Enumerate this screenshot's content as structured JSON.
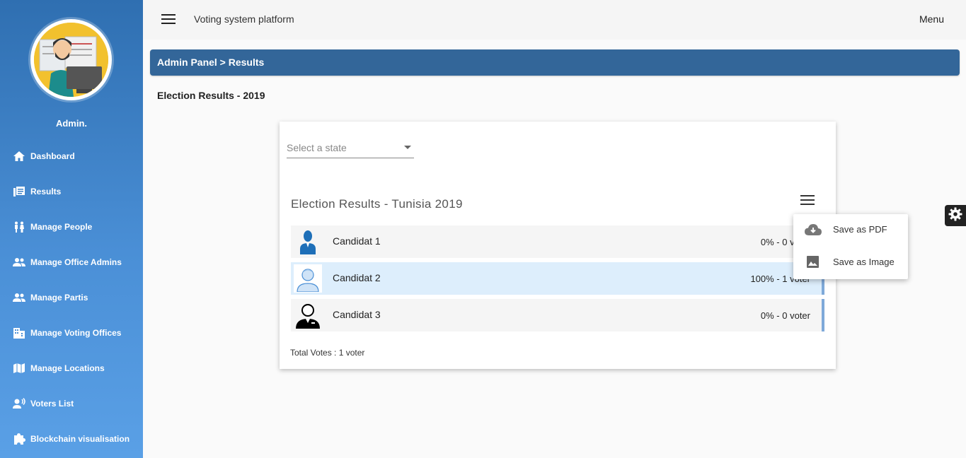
{
  "header": {
    "app_title": "Voting system platform",
    "menu_label": "Menu"
  },
  "sidebar": {
    "admin_name": "Admin.",
    "items": [
      {
        "label": "Dashboard",
        "icon": "home-icon"
      },
      {
        "label": "Results",
        "icon": "list-icon"
      },
      {
        "label": "Manage People",
        "icon": "people-icon"
      },
      {
        "label": "Manage Office Admins",
        "icon": "group-icon"
      },
      {
        "label": "Manage Partis",
        "icon": "group-icon"
      },
      {
        "label": "Manage Voting Offices",
        "icon": "building-icon"
      },
      {
        "label": "Manage Locations",
        "icon": "map-icon"
      },
      {
        "label": "Voters List",
        "icon": "voice-icon"
      },
      {
        "label": "Blockchain visualisation",
        "icon": "puzzle-icon"
      }
    ]
  },
  "breadcrumb": "Admin Panel > Results",
  "page_title": "Election Results - 2019",
  "card": {
    "select_placeholder": "Select a state",
    "chart_title": "Election Results - Tunisia 2019",
    "candidates": [
      {
        "name": "Candidat 1",
        "value": "0% - 0 voter",
        "highlighted": false
      },
      {
        "name": "Candidat 2",
        "value": "100% - 1 voter",
        "highlighted": true
      },
      {
        "name": "Candidat 3",
        "value": "0% - 0 voter",
        "highlighted": false
      }
    ],
    "total": "Total Votes : 1 voter"
  },
  "export_menu": {
    "items": [
      {
        "label": "Save as PDF",
        "icon": "cloud-download-icon"
      },
      {
        "label": "Save as Image",
        "icon": "image-icon"
      }
    ]
  },
  "colors": {
    "sidebar_top": "#2f6fb1",
    "sidebar_bottom": "#5aa0e6",
    "breadcrumb_bg": "#336699",
    "row_highlight": "#ddeefc",
    "row_accent": "#7fa9d9"
  }
}
